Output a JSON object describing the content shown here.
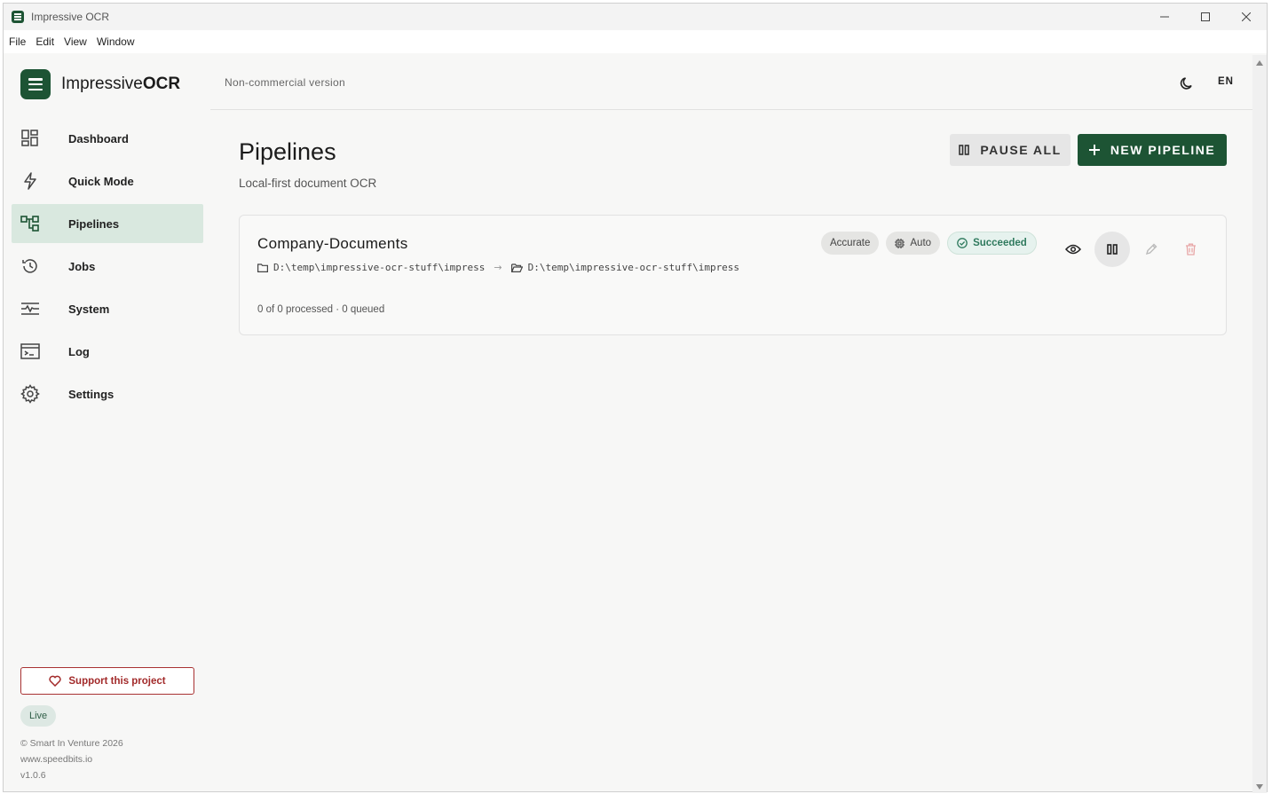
{
  "window": {
    "title": "Impressive OCR",
    "minimize": "—",
    "maximize": "☐",
    "close": "✕"
  },
  "menu": [
    "File",
    "Edit",
    "View",
    "Window"
  ],
  "brand": {
    "name_light": "Impressive",
    "name_bold": "OCR",
    "color": "#1d5434"
  },
  "header": {
    "version": "Non-commercial version",
    "language": "EN"
  },
  "sidebar": {
    "items": [
      {
        "label": "Dashboard",
        "icon": "dashboard-icon"
      },
      {
        "label": "Quick Mode",
        "icon": "lightning-icon"
      },
      {
        "label": "Pipelines",
        "icon": "pipelines-icon",
        "active": true
      },
      {
        "label": "Jobs",
        "icon": "history-icon"
      },
      {
        "label": "System",
        "icon": "system-icon"
      },
      {
        "label": "Log",
        "icon": "terminal-icon"
      },
      {
        "label": "Settings",
        "icon": "gear-icon"
      }
    ],
    "support": "Support this project",
    "status": "Live",
    "copyright": "© Smart In Venture 2026",
    "website": "www.speedbits.io",
    "version": "v1.0.6"
  },
  "page": {
    "title": "Pipelines",
    "subtitle": "Local-first document OCR",
    "pause_all": "PAUSE ALL",
    "new_pipeline": "NEW PIPELINE"
  },
  "pipelines": [
    {
      "name": "Company-Documents",
      "source": "D:\\temp\\impressive-ocr-stuff\\impress",
      "target": "D:\\temp\\impressive-ocr-stuff\\impress",
      "mode": "Accurate",
      "engine": "Auto",
      "status": "Succeeded",
      "progress": "0 of 0 processed · 0 queued"
    }
  ],
  "colors": {
    "accent": "#1d5434",
    "active_bg": "#d9e8df",
    "success": "#2f7a5e",
    "danger": "#a22a2a"
  }
}
